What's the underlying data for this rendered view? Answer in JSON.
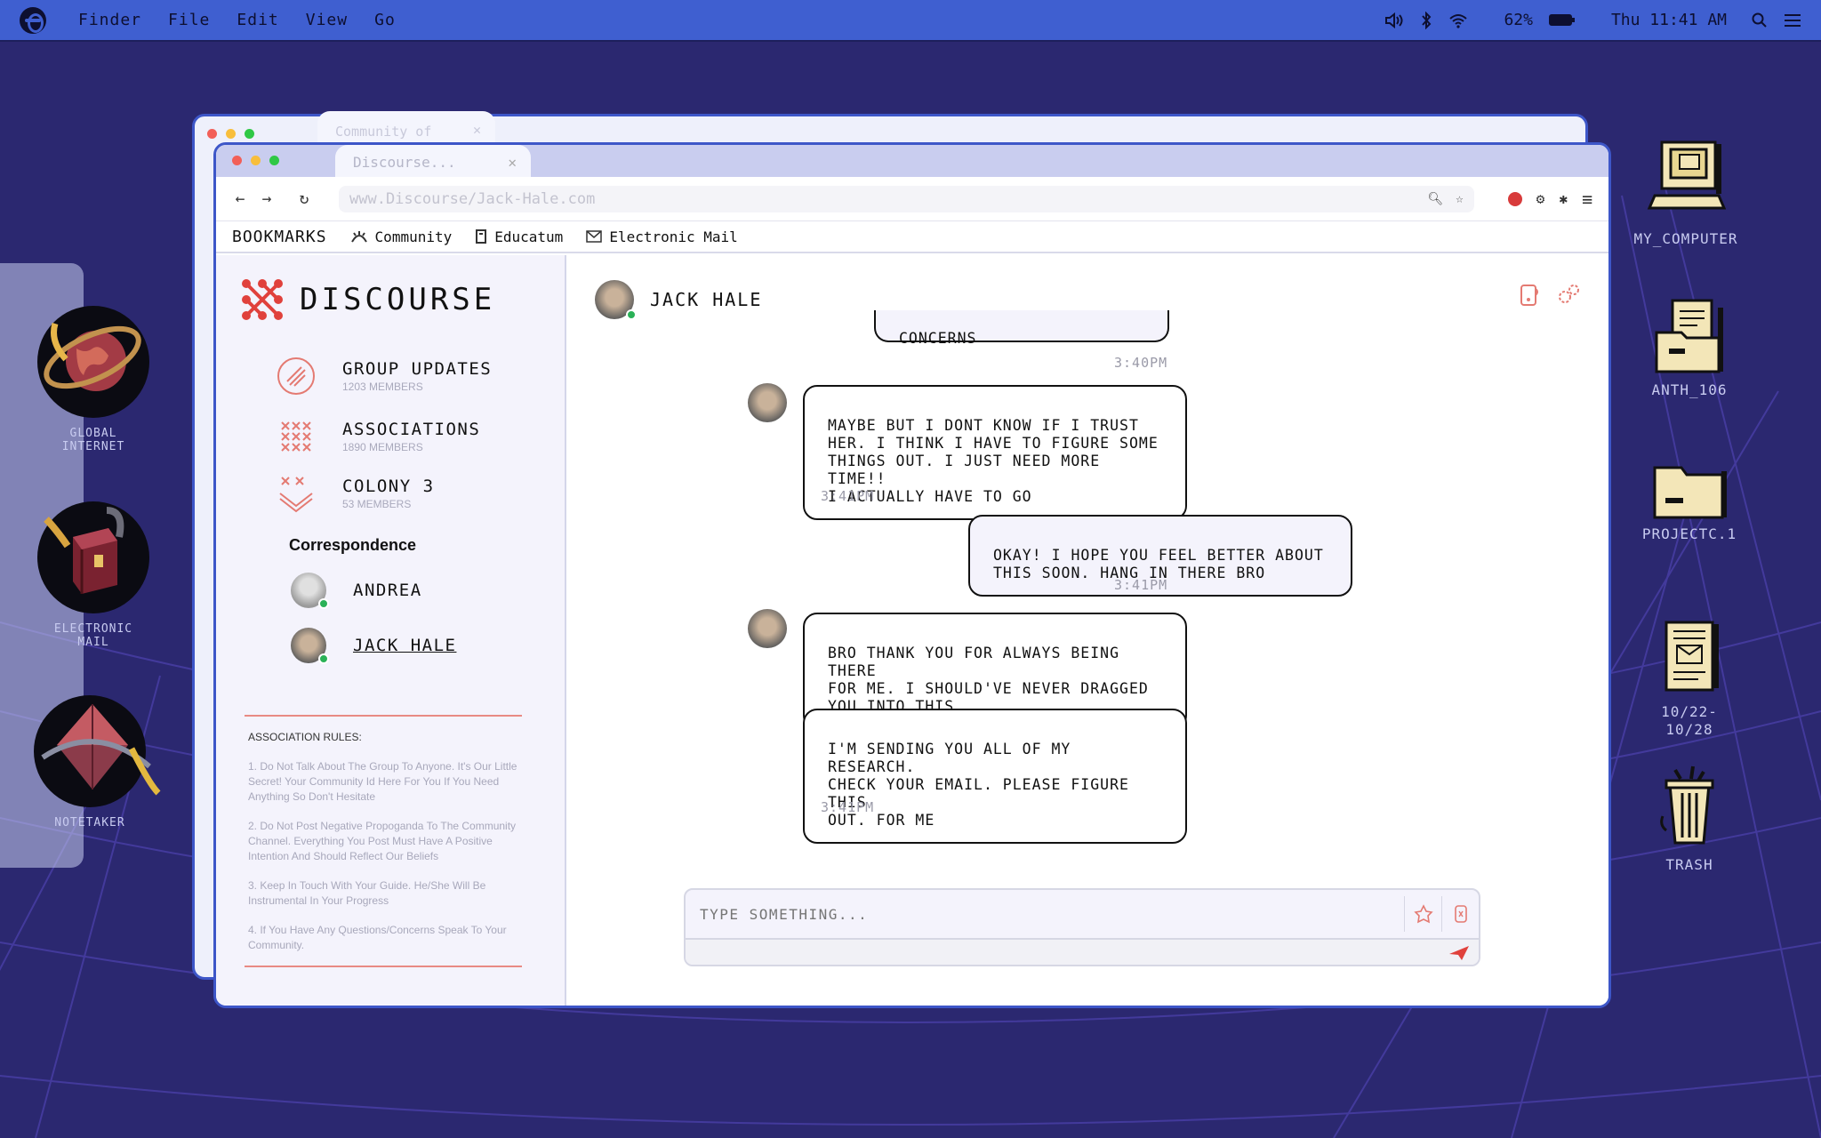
{
  "menubar": {
    "items": [
      "Finder",
      "File",
      "Edit",
      "View",
      "Go"
    ],
    "battery": "62%",
    "clock": "Thu 11:41 AM"
  },
  "dock": {
    "items": [
      {
        "label": "GLOBAL\nINTERNET",
        "icon": "globe-icon"
      },
      {
        "label": "ELECTRONIC\nMAIL",
        "icon": "mailbox-icon"
      },
      {
        "label": "NOTETAKER",
        "icon": "notetaker-icon"
      }
    ]
  },
  "desktop": {
    "icons": [
      {
        "label": "MY_COMPUTER",
        "icon": "computer-icon"
      },
      {
        "label": "ANTH_106",
        "icon": "folder-docs-icon"
      },
      {
        "label": "PROJECTC.1",
        "icon": "folder-icon"
      },
      {
        "label": "10/22-\n10/28",
        "icon": "document-icon"
      },
      {
        "label": "TRASH",
        "icon": "trash-icon"
      }
    ]
  },
  "browser": {
    "back_tab": "Community of",
    "active_tab": "Discourse...",
    "url": "www.Discourse/Jack-Hale.com",
    "bookmarks_label": "BOOKMARKS",
    "bookmarks": [
      {
        "label": "Community",
        "icon": "community-icon"
      },
      {
        "label": "Educatum",
        "icon": "book-icon"
      },
      {
        "label": "Electronic Mail",
        "icon": "mail-icon"
      }
    ]
  },
  "sidebar": {
    "brand": "DISCOURSE",
    "groups": [
      {
        "name": "GROUP UPDATES",
        "members": "1203 MEMBERS"
      },
      {
        "name": "ASSOCIATIONS",
        "members": "1890 MEMBERS"
      },
      {
        "name": "COLONY 3",
        "members": "53 MEMBERS"
      }
    ],
    "correspondence_title": "Correspondence",
    "contacts": [
      {
        "name": "ANDREA"
      },
      {
        "name": "JACK HALE"
      }
    ],
    "rules_title": "ASSOCIATION RULES:",
    "rules": [
      "1. Do Not Talk About The Group To Anyone. It's Our Little Secret! Your Community Id Here For You If You Need Anything So Don't Hesitate",
      "2. Do Not Post Negative Propoganda To The Community Channel. Everything You Post Must Have A Positive Intention And Should Reflect Our Beliefs",
      "3. Keep In Touch With Your Guide. He/She Will Be Instrumental In Your Progress",
      "4. If You Have Any Questions/Concerns Speak To Your Community."
    ]
  },
  "chat": {
    "contact_name": "JACK HALE",
    "messages": [
      {
        "from": "me",
        "text": "CONCERNS",
        "time": "3:40PM"
      },
      {
        "from": "them",
        "text": "MAYBE BUT I DONT KNOW IF I TRUST\nHER. I THINK I HAVE TO FIGURE SOME\nTHINGS OUT. I JUST NEED MORE TIME!!\nI ACTUALLY HAVE TO GO",
        "time": "3:41PM"
      },
      {
        "from": "me",
        "text": "OKAY! I HOPE YOU FEEL BETTER ABOUT\nTHIS SOON. HANG IN THERE BRO",
        "time": "3:41PM"
      },
      {
        "from": "them",
        "text": "BRO THANK YOU FOR ALWAYS BEING THERE\nFOR ME. I SHOULD'VE NEVER DRAGGED\nYOU INTO THIS.",
        "time": ""
      },
      {
        "from": "them",
        "text": "I'M SENDING YOU ALL OF MY RESEARCH.\nCHECK YOUR EMAIL. PLEASE FIGURE THIS\nOUT. FOR ME",
        "time": "3:41PM"
      }
    ],
    "input_placeholder": "TYPE SOMETHING..."
  },
  "colors": {
    "desktop_bg": "#2b2870",
    "menubar": "#3f5fd0",
    "accent_red": "#e0413c",
    "online": "#2ab157",
    "sidebar_bg": "#f4f3fc"
  }
}
